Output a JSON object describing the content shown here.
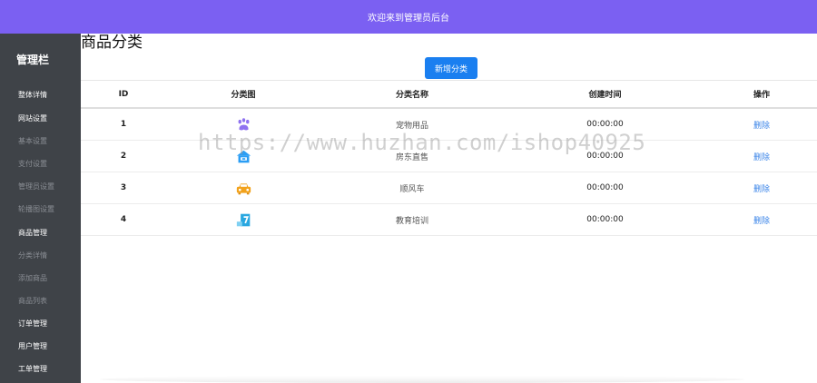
{
  "header": {
    "welcome": "欢迎来到管理员后台"
  },
  "sidebar": {
    "title": "管理栏",
    "items": [
      {
        "label": "整体详情",
        "state": "active"
      },
      {
        "label": "网站设置",
        "state": "active"
      },
      {
        "label": "基本设置",
        "state": "muted"
      },
      {
        "label": "支付设置",
        "state": "muted"
      },
      {
        "label": "管理员设置",
        "state": "muted"
      },
      {
        "label": "轮播图设置",
        "state": "muted"
      },
      {
        "label": "商品管理",
        "state": "active"
      },
      {
        "label": "分类详情",
        "state": "muted"
      },
      {
        "label": "添加商品",
        "state": "muted"
      },
      {
        "label": "商品列表",
        "state": "muted"
      },
      {
        "label": "订单管理",
        "state": "active"
      },
      {
        "label": "用户管理",
        "state": "active"
      },
      {
        "label": "工单管理",
        "state": "active"
      }
    ]
  },
  "main": {
    "title": "商品分类",
    "add_button": "新增分类",
    "table": {
      "headers": [
        "ID",
        "分类图",
        "分类名称",
        "创建时间",
        "操作"
      ],
      "rows": [
        {
          "id": "1",
          "icon": "paw-icon",
          "name": "宠物用品",
          "time": "00:00:00",
          "action": "删除"
        },
        {
          "id": "2",
          "icon": "house-icon",
          "name": "房东直售",
          "time": "00:00:00",
          "action": "删除"
        },
        {
          "id": "3",
          "icon": "car-icon",
          "name": "顺风车",
          "time": "00:00:00",
          "action": "删除"
        },
        {
          "id": "4",
          "icon": "education-icon",
          "name": "教育培训",
          "time": "00:00:00",
          "action": "删除"
        }
      ]
    }
  },
  "watermark": "https://www.huzhan.com/ishop40925",
  "colors": {
    "topbar": "#7b60f2",
    "sidebar": "#3f4348",
    "primary_button": "#1a7ff0",
    "link": "#3a84e8",
    "paw_icon": "#8f72f0",
    "house_icon": "#2a9df4",
    "car_icon": "#f2a21b",
    "education_icon": "#29a7e0"
  }
}
